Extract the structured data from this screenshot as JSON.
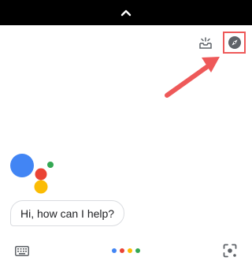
{
  "assistant": {
    "greeting": "Hi, how can I help?"
  },
  "icons": {
    "collapse": "chevron-up-icon",
    "updates": "inbox-updates-icon",
    "explore": "compass-icon",
    "keyboard": "keyboard-icon",
    "lens": "lens-icon",
    "assistant_logo": "google-assistant-logo"
  },
  "colors": {
    "top_bar": "#000000",
    "highlight": "#ee5959",
    "icon_gray": "#5f6368",
    "blue": "#4285f4",
    "red": "#ea4335",
    "yellow": "#fbbc04",
    "green": "#34a853"
  }
}
